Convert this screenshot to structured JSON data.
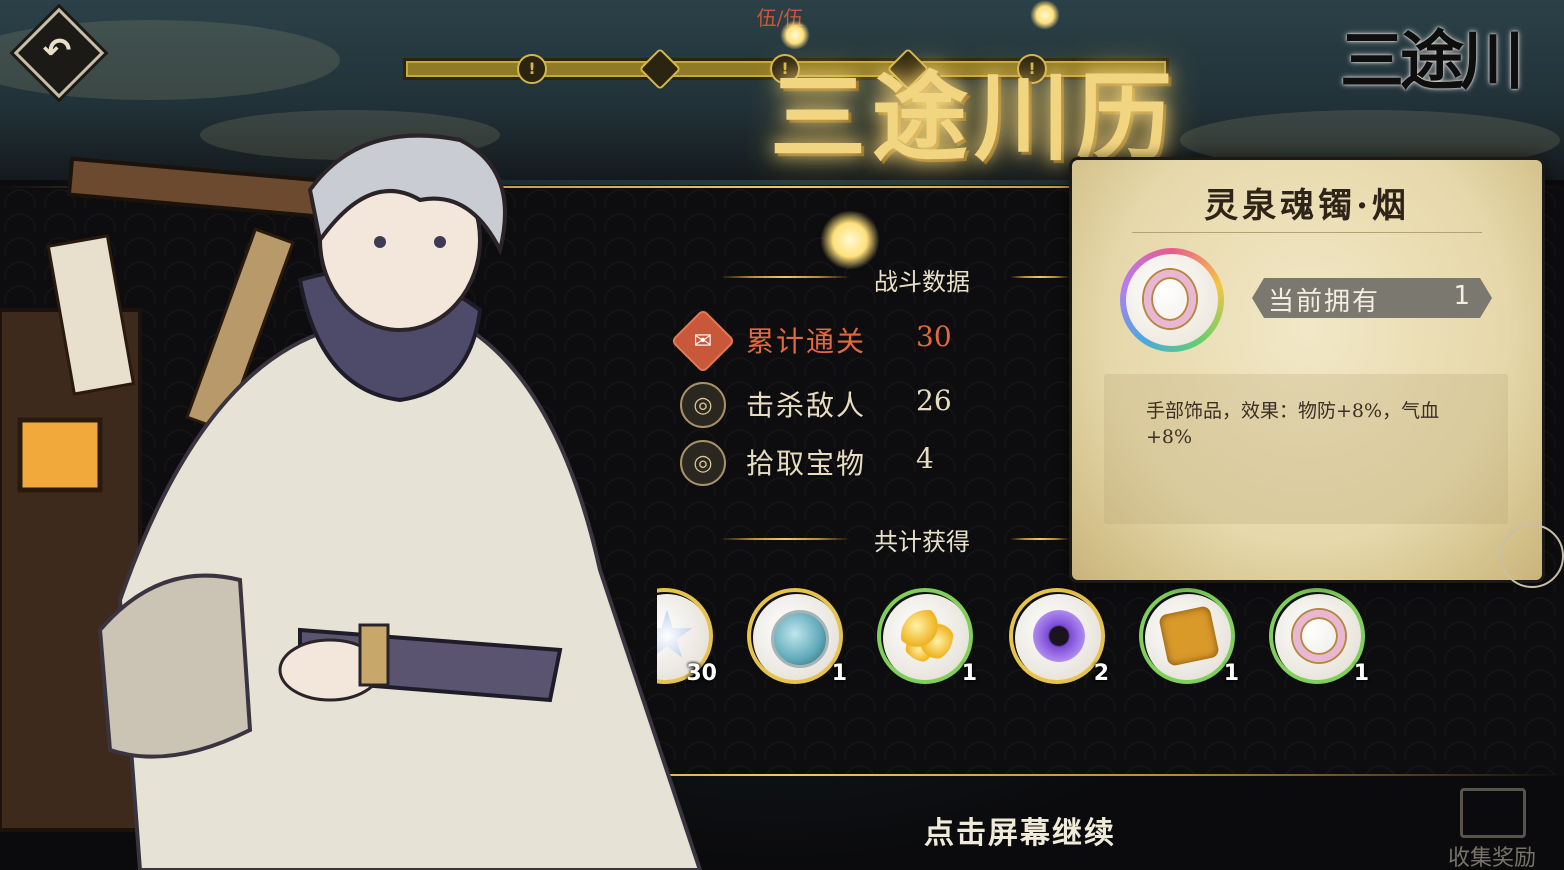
{
  "header": {
    "progress_label": "伍/伍",
    "title_banner": "三途川历",
    "logo_text": "三途川",
    "nodes": [
      "!",
      "⚔",
      "!",
      "⚔",
      "!"
    ]
  },
  "battle_data": {
    "section_title": "战斗数据",
    "stats": [
      {
        "label": "累计通关",
        "value": "30",
        "icon": "scroll-icon",
        "highlighted": true
      },
      {
        "label": "击杀敌人",
        "value": "26",
        "icon": "tomoe-icon",
        "highlighted": false
      },
      {
        "label": "拾取宝物",
        "value": "4",
        "icon": "tomoe-icon",
        "highlighted": false
      }
    ]
  },
  "rewards": {
    "section_title": "共计获得",
    "items": [
      {
        "icon": "star-crystal-icon",
        "qty": "30",
        "color": "#c9d8f0",
        "quality": "#e6c34a"
      },
      {
        "icon": "spirit-gourd-icon",
        "qty": "1",
        "color": "#5fa8b8",
        "quality": "#e6c34a"
      },
      {
        "icon": "golden-orbs-icon",
        "qty": "1",
        "color": "#f0b21e",
        "quality": "#7fcf5a"
      },
      {
        "icon": "purple-lotus-icon",
        "qty": "2",
        "color": "#7b4bd6",
        "quality": "#e6c34a"
      },
      {
        "icon": "golden-cloth-icon",
        "qty": "1",
        "color": "#d99a2a",
        "quality": "#7fcf5a"
      },
      {
        "icon": "bracelet-icon",
        "qty": "1",
        "color": "#e7b7d3",
        "quality": "#7fcf5a"
      }
    ]
  },
  "tooltip": {
    "item_name": "灵泉魂镯·烟",
    "owned_label": "当前拥有",
    "owned_value": "1",
    "description": "手部饰品，效果：物防+8%，气血+8%"
  },
  "footer": {
    "continue_text": "点击屏幕继续",
    "collect_label": "收集奖励"
  },
  "colors": {
    "accent_gold": "#f2d580",
    "highlight_orange": "#e2683d",
    "parchment": "#f2e8c7"
  }
}
